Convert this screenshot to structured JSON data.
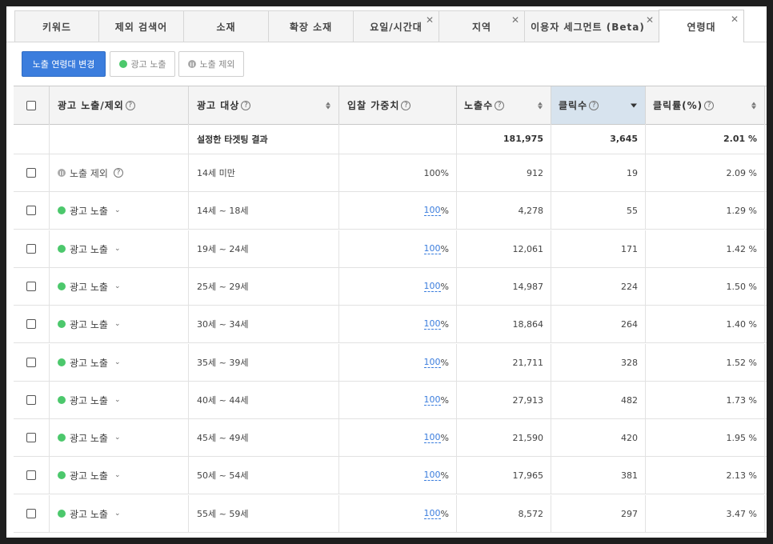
{
  "tabs": [
    {
      "label": "키워드",
      "closable": false
    },
    {
      "label": "제외 검색어",
      "closable": false
    },
    {
      "label": "소재",
      "closable": false
    },
    {
      "label": "확장 소재",
      "closable": false
    },
    {
      "label": "요일/시간대",
      "closable": true
    },
    {
      "label": "지역",
      "closable": true
    },
    {
      "label": "이용자 세그먼트 (Beta)",
      "closable": true
    },
    {
      "label": "연령대",
      "closable": true,
      "active": true
    }
  ],
  "toolbar": {
    "change_label": "노출 연령대 변경",
    "show_label": "광고 노출",
    "exclude_label": "노출 제외"
  },
  "table": {
    "headers": {
      "status": "광고 노출/제외",
      "target": "광고 대상",
      "bid_weight": "입찰 가중치",
      "impressions": "노출수",
      "clicks": "클릭수",
      "ctr": "클릭률(%)"
    },
    "summary": {
      "label": "설정한 타겟팅 결과",
      "impressions": "181,975",
      "clicks": "3,645",
      "ctr": "2.01 %"
    },
    "rows": [
      {
        "status": "노출 제외",
        "status_type": "excluded",
        "target": "14세 미만",
        "weight": "100%",
        "impressions": "912",
        "clicks": "19",
        "ctr": "2.09 %"
      },
      {
        "status": "광고 노출",
        "status_type": "shown",
        "target": "14세 ~ 18세",
        "weight": "100",
        "impressions": "4,278",
        "clicks": "55",
        "ctr": "1.29 %"
      },
      {
        "status": "광고 노출",
        "status_type": "shown",
        "target": "19세 ~ 24세",
        "weight": "100",
        "impressions": "12,061",
        "clicks": "171",
        "ctr": "1.42 %"
      },
      {
        "status": "광고 노출",
        "status_type": "shown",
        "target": "25세 ~ 29세",
        "weight": "100",
        "impressions": "14,987",
        "clicks": "224",
        "ctr": "1.50 %"
      },
      {
        "status": "광고 노출",
        "status_type": "shown",
        "target": "30세 ~ 34세",
        "weight": "100",
        "impressions": "18,864",
        "clicks": "264",
        "ctr": "1.40 %"
      },
      {
        "status": "광고 노출",
        "status_type": "shown",
        "target": "35세 ~ 39세",
        "weight": "100",
        "impressions": "21,711",
        "clicks": "328",
        "ctr": "1.52 %"
      },
      {
        "status": "광고 노출",
        "status_type": "shown",
        "target": "40세 ~ 44세",
        "weight": "100",
        "impressions": "27,913",
        "clicks": "482",
        "ctr": "1.73 %"
      },
      {
        "status": "광고 노출",
        "status_type": "shown",
        "target": "45세 ~ 49세",
        "weight": "100",
        "impressions": "21,590",
        "clicks": "420",
        "ctr": "1.95 %"
      },
      {
        "status": "광고 노출",
        "status_type": "shown",
        "target": "50세 ~ 54세",
        "weight": "100",
        "impressions": "17,965",
        "clicks": "381",
        "ctr": "2.13 %"
      },
      {
        "status": "광고 노출",
        "status_type": "shown",
        "target": "55세 ~ 59세",
        "weight": "100",
        "impressions": "8,572",
        "clicks": "297",
        "ctr": "3.47 %"
      }
    ],
    "percent_suffix": "%",
    "help_mark": "?"
  },
  "colors": {
    "primary": "#3b7ddd",
    "shown_dot": "#4cc86c",
    "sorted_header": "#d7e3ee"
  }
}
